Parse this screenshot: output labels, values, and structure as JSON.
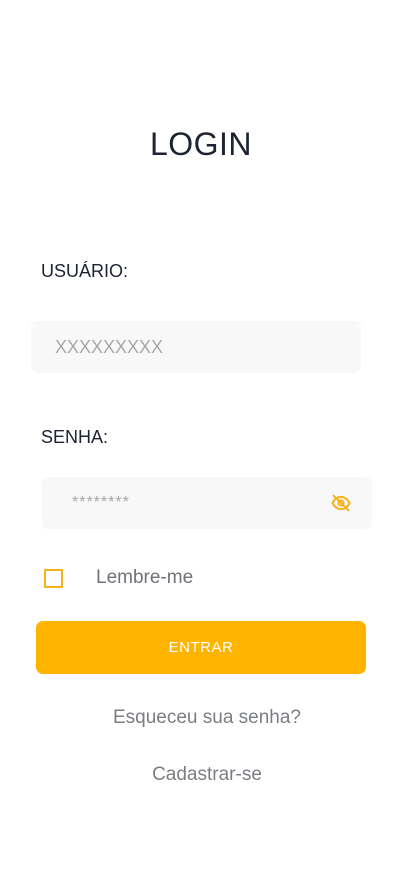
{
  "page": {
    "title": "LOGIN"
  },
  "form": {
    "user": {
      "label": "USUÁRIO:",
      "placeholder": "XXXXXXXXX",
      "value": ""
    },
    "password": {
      "label": "SENHA:",
      "placeholder": "********",
      "value": "",
      "toggle_icon": "eye-off-icon"
    },
    "remember": {
      "label": "Lembre-me",
      "checked": false
    },
    "submit_label": "ENTRAR"
  },
  "links": {
    "forgot": "Esqueceu sua senha?",
    "signup": "Cadastrar-se"
  },
  "colors": {
    "accent": "#ffb400",
    "field_bg": "#f8f8f8",
    "text_dark": "#1d2333",
    "text_muted": "#7a7d82"
  }
}
